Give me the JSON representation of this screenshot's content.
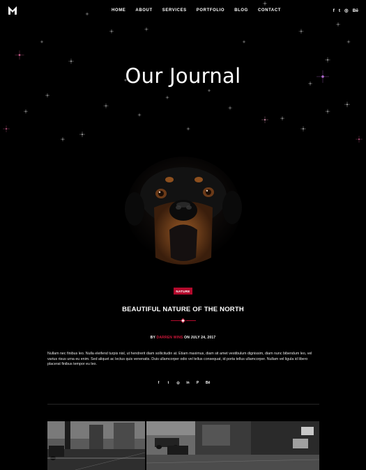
{
  "header": {
    "logo_letter": "M",
    "nav": [
      "HOME",
      "ABOUT",
      "SERVICES",
      "PORTFOLIO",
      "BLOG",
      "CONTACT"
    ],
    "social_icons": [
      "facebook-icon",
      "twitter-icon",
      "instagram-icon",
      "behance-icon"
    ],
    "social_glyphs": [
      "f",
      "t",
      "◎",
      "Bē"
    ]
  },
  "hero": {
    "title": "Our Journal"
  },
  "post": {
    "category": "NATURE",
    "title": "BEAUTIFUL NATURE OF THE NORTH",
    "meta_prefix": "BY",
    "author": "DARREN WINS",
    "meta_middle": "ON",
    "date": "JULY 24, 2017",
    "excerpt": "Nullam nec finibus leo. Nulla eleifend turpis nisl, ut hendrerit diam sollicitudin at. Etiam maximus, diam sit amet vestibulum dignissim, diam nunc bibendum leo, vel varius risus urna eu enim. Sed aliquet ac lectus quis venenatis. Duis ullamcorper odio vel tellus consequat, id porta tellus ullamcorper. Nullam vel ligula id libero placerat finibus tempor eu leo.",
    "share_icons": [
      "facebook-icon",
      "twitter-icon",
      "instagram-icon",
      "linkedin-icon",
      "pinterest-icon",
      "behance-icon"
    ],
    "share_glyphs": [
      "f",
      "t",
      "◎",
      "in",
      "P",
      "Bē"
    ]
  },
  "colors": {
    "background": "#000000",
    "accent": "#b20a2c",
    "author": "#d1183b"
  }
}
